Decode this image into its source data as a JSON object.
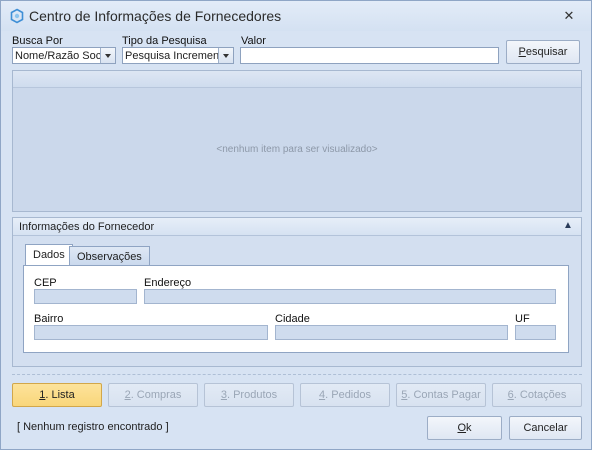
{
  "window": {
    "title": "Centro de Informações de Fornecedores",
    "close_glyph": "✕"
  },
  "search": {
    "busca_por_label": "Busca Por",
    "busca_por_value": "Nome/Razão Social",
    "tipo_pesquisa_label": "Tipo da Pesquisa",
    "tipo_pesquisa_value": "Pesquisa Incremental",
    "valor_label": "Valor",
    "valor_value": "",
    "pesquisar_mnemonic": "P",
    "pesquisar_rest": "esquisar"
  },
  "grid": {
    "empty_message": "<nenhum item para ser visualizado>"
  },
  "supplier_info": {
    "title": "Informações do Fornecedor",
    "tabs": [
      {
        "label": "Dados",
        "selected": true
      },
      {
        "label": "Observações",
        "selected": false
      }
    ],
    "fields": {
      "cep_label": "CEP",
      "endereco_label": "Endereço",
      "bairro_label": "Bairro",
      "cidade_label": "Cidade",
      "uf_label": "UF"
    }
  },
  "actions": [
    {
      "mnemonic": "1",
      "rest": ". Lista",
      "state": "active"
    },
    {
      "mnemonic": "2",
      "rest": ". Compras",
      "state": "disabled"
    },
    {
      "mnemonic": "3",
      "rest": ". Produtos",
      "state": "disabled"
    },
    {
      "mnemonic": "4",
      "rest": ". Pedidos",
      "state": "disabled"
    },
    {
      "mnemonic": "5",
      "rest": ". Contas Pagar",
      "state": "disabled"
    },
    {
      "mnemonic": "6",
      "rest": ". Cotações",
      "state": "disabled"
    }
  ],
  "footer": {
    "status": "[ Nenhum registro encontrado ]",
    "ok_mnemonic": "O",
    "ok_rest": "k",
    "cancel_label": "Cancelar"
  },
  "colors": {
    "window_bg": "#d7e3f3",
    "active_button": "#f9d67a",
    "disabled_text": "#9aa6b6"
  }
}
